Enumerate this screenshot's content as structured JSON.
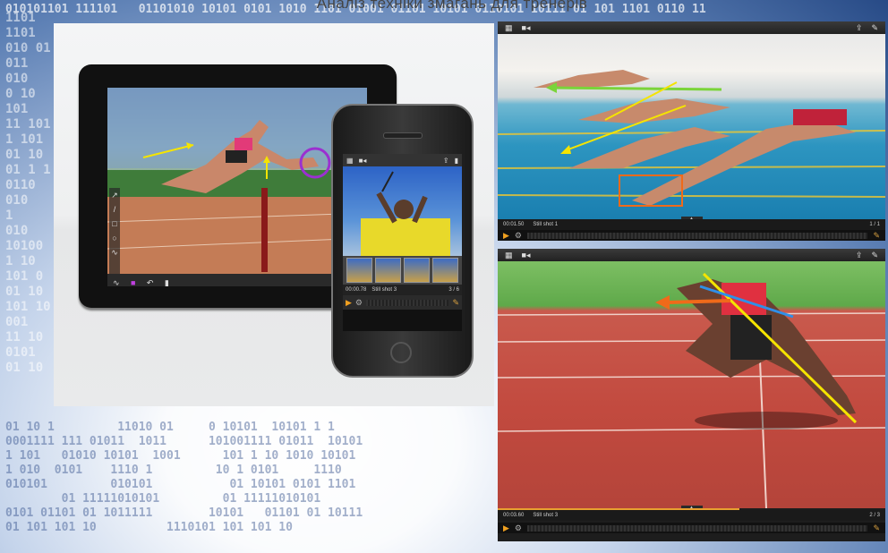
{
  "caption": "Аналіз техніки змагань для тренерів",
  "binary": {
    "top": "010101101 111101   01101010 10101 0101 1010 1101 01001 01101 10101 0110101 10111 01 101 1101 0110 11",
    "left": "1101\n1101\n010 01\n011\n010\n0 10\n101\n11 101\n1 101\n01 10\n01 1 1\n0110\n010\n1\n010\n10100\n1 10\n101 0\n01 10\n101 10\n001\n11 10\n0101\n01 10",
    "bottom": "01 10 1         11010 01     0 10101  10101 1 1\n0001111 111 01011  1011      101001111 01011  10101\n1 101   01010 10101  1001      101 1 10 1010 10101\n1 010  0101    1110 1         10 1 0101     1110\n010101         010101           01 10101 0101 1101\n        01 11111010101         01 11111010101\n0101 01101 01 1011111        10101   01101 01 10111\n01 101 101 10          1110101 101 101 10"
  },
  "ipad": {
    "tools": [
      "↗",
      "/",
      "□",
      "○",
      "∿"
    ],
    "bottom_tools": [
      "∿",
      "■",
      "↶",
      "▮"
    ]
  },
  "iphone": {
    "status_time": "00:00.78",
    "status_label": "Still shot 3",
    "status_count": "3 / 6"
  },
  "video_top": {
    "time": "00:01.50",
    "label": "Still shot 1",
    "count": "1 / 1"
  },
  "video_bottom": {
    "time": "00:03.60",
    "label": "Still shot 3",
    "count": "2 / 3"
  },
  "icons": {
    "grid": "▦",
    "camera": "■◂",
    "share": "⇪",
    "pencil": "✎",
    "play": "▶",
    "gear": "⚙",
    "note": "✎",
    "trash": "▮",
    "chevron": "▲"
  },
  "colors": {
    "annotation_yellow": "#f5e400",
    "annotation_green": "#7ad43a",
    "annotation_orange": "#f06a1a",
    "annotation_blue": "#2f8fe8",
    "annotation_purple": "#9b30d0",
    "accent": "#f0a020"
  }
}
